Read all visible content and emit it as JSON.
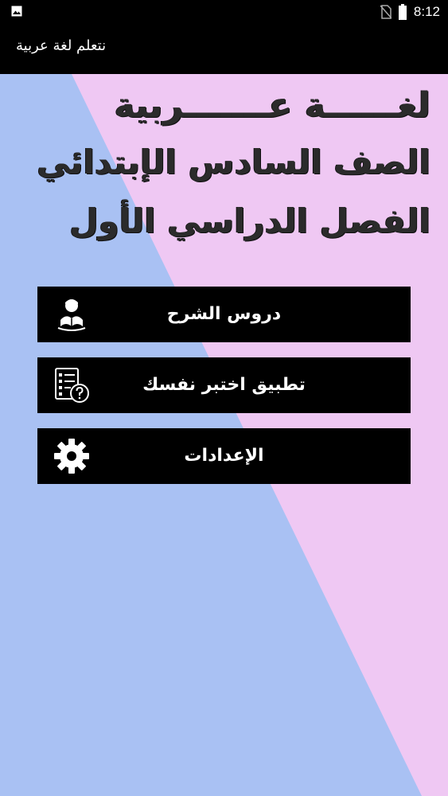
{
  "status_bar": {
    "time": "8:12",
    "left_icon": "image-icon",
    "right_icons": [
      "no-sim-icon",
      "battery-icon"
    ]
  },
  "app_bar": {
    "title": "نتعلم لغة عربية"
  },
  "headline": {
    "line1": "لغــــــة عـــــــربية",
    "line2": "الصف السادس الإبتدائي",
    "line3": "الفصل الدراسي الأول"
  },
  "menu": {
    "items": [
      {
        "label": "دروس الشرح",
        "icon": "student-reading-icon"
      },
      {
        "label": "تطبيق اختبر نفسك",
        "icon": "quiz-checklist-icon"
      },
      {
        "label": "الإعدادات",
        "icon": "gear-icon"
      }
    ]
  },
  "colors": {
    "background_blue": "#a9c1f3",
    "background_pink": "#efc8f3",
    "button_bg": "#000000",
    "button_text": "#ffffff",
    "headline_text": "#2b2b2b"
  }
}
